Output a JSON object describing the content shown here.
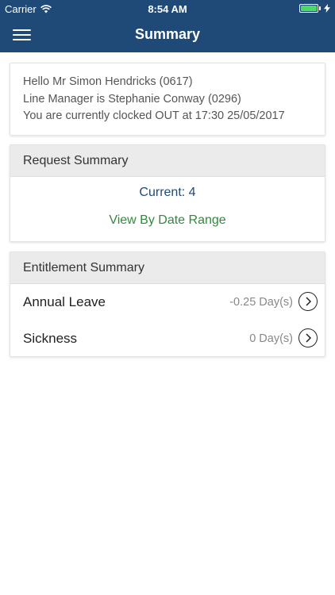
{
  "status": {
    "carrier": "Carrier",
    "time": "8:54 AM"
  },
  "nav": {
    "title": "Summary",
    "menu_icon": "hamburger-menu-icon"
  },
  "greeting": {
    "line1": "Hello Mr Simon Hendricks (0617)",
    "line2": "Line Manager is Stephanie Conway (0296)",
    "line3": "You are currently clocked OUT at 17:30 25/05/2017"
  },
  "request_summary": {
    "title": "Request Summary",
    "current": "Current: 4",
    "date_range_link": "View By Date Range"
  },
  "entitlement_summary": {
    "title": "Entitlement Summary",
    "items": [
      {
        "label": "Annual Leave",
        "value": "-0.25 Day(s)"
      },
      {
        "label": "Sickness",
        "value": "0 Day(s)"
      }
    ]
  },
  "colors": {
    "nav_bg": "#1f4a78",
    "link_green": "#2e8b3a",
    "current_blue": "#1f4a78",
    "battery": "#4cd964"
  }
}
